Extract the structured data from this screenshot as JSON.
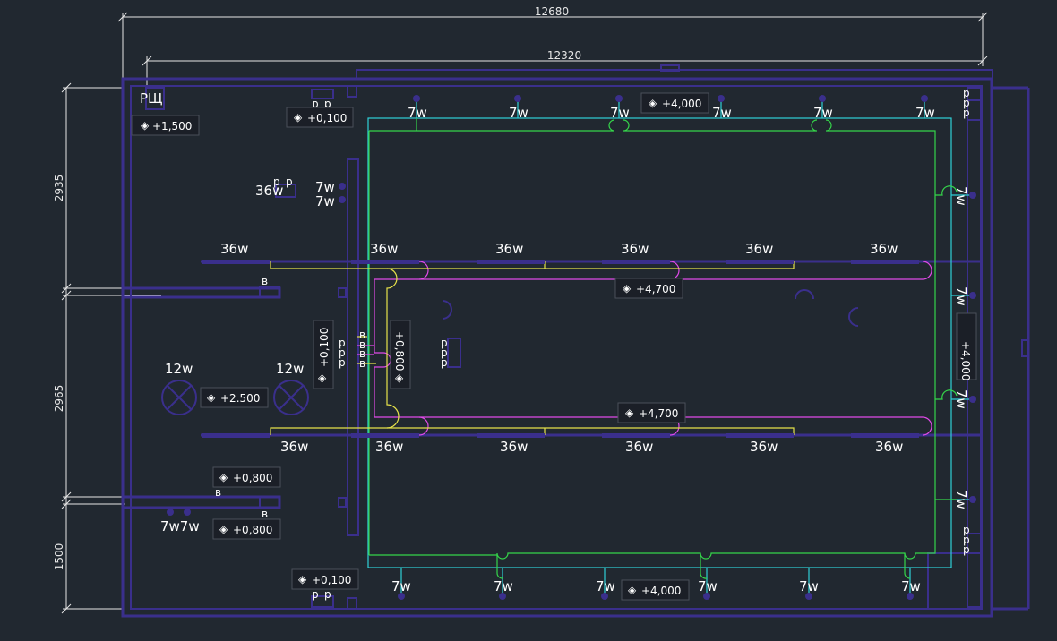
{
  "dimensions": {
    "overall_width": "12680",
    "inner_width": "12320",
    "left_top": "2935",
    "left_middle": "2965",
    "left_bottom": "1500"
  },
  "panel_label": "РЩ",
  "lamp_labels": {
    "small": "7w",
    "tube": "36w",
    "round": "12w",
    "double_small": "7w7w"
  },
  "switch_letters": {
    "b": "в",
    "p": "р"
  },
  "elevations": {
    "panel": "+1,500",
    "top_left": "+0,100",
    "top_middle": "+4,000",
    "right_side": "+4,000",
    "upper_tube": "+4,700",
    "lower_tube": "+4,700",
    "left_vertical": "+0,100",
    "center_vertical": "+0,800",
    "round_lamp": "+2.500",
    "lower_left_1": "+0,800",
    "lower_left_2": "+0,800",
    "bottom_left": "+0,100",
    "bottom_middle": "+4,000"
  },
  "colors": {
    "background": "#212830",
    "walls": "#3a2f8c",
    "cyan_circuit": "#2fd0d8",
    "green_circuit": "#35d54a",
    "magenta_circuit": "#e04ae8",
    "yellow_circuit": "#e6e24a"
  }
}
